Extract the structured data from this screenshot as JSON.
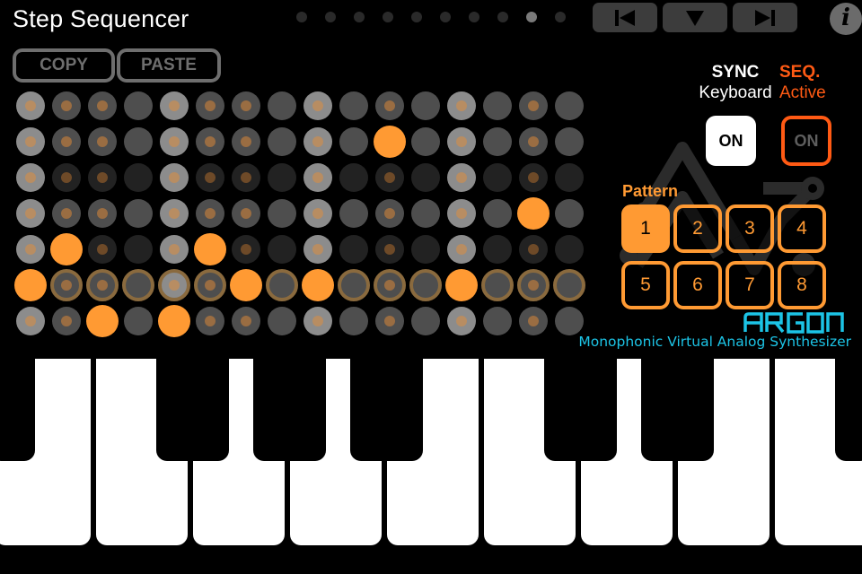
{
  "header": {
    "title": "Step Sequencer",
    "page_count": 10,
    "active_page": 9
  },
  "transport": {
    "prev_icon": "skip-back-icon",
    "menu_icon": "triangle-down-icon",
    "next_icon": "skip-forward-icon"
  },
  "info_button": {
    "icon": "info-icon",
    "glyph": "i"
  },
  "clipboard": {
    "copy_label": "COPY",
    "paste_label": "PASTE"
  },
  "sequencer": {
    "columns": 16,
    "rows": 7,
    "legend": {
      "L": "light-gray step",
      "D": "dark-gray step",
      "K": "very-dark step",
      "O": "active note (orange)",
      "R": "ringed step (playhead row)"
    },
    "grid": [
      [
        "Ld",
        "Dd",
        "Dd",
        "D",
        "Ld",
        "Dd",
        "Dd",
        "D",
        "Ld",
        "D",
        "Dd",
        "D",
        "Ld",
        "D",
        "Dd",
        "D"
      ],
      [
        "Ld",
        "Dd",
        "Dd",
        "D",
        "Ld",
        "Dd",
        "Dd",
        "D",
        "Ld",
        "D",
        "O",
        "D",
        "Ld",
        "D",
        "Dd",
        "D"
      ],
      [
        "Ld",
        "Kd",
        "Kd",
        "K",
        "Ld",
        "Kd",
        "Kd",
        "K",
        "Ld",
        "K",
        "Kd",
        "K",
        "Ld",
        "K",
        "Kd",
        "K"
      ],
      [
        "Ld",
        "Dd",
        "Dd",
        "D",
        "Ld",
        "Dd",
        "Dd",
        "D",
        "Ld",
        "D",
        "Dd",
        "D",
        "Ld",
        "D",
        "O",
        "D"
      ],
      [
        "Ld",
        "O",
        "Kd",
        "K",
        "Ld",
        "O",
        "Kd",
        "K",
        "Ld",
        "K",
        "Kd",
        "K",
        "Ld",
        "K",
        "Kd",
        "K"
      ],
      [
        "O",
        "Rd",
        "Rd",
        "R",
        "RLd",
        "Rd",
        "O",
        "R",
        "O",
        "R",
        "Rd",
        "R",
        "O",
        "R",
        "Rd",
        "R"
      ],
      [
        "Ld",
        "Dd",
        "O",
        "D",
        "O",
        "Dd",
        "Dd",
        "D",
        "Ld",
        "D",
        "Dd",
        "D",
        "Ld",
        "D",
        "Dd",
        "D"
      ]
    ]
  },
  "sync": {
    "heading": "SYNC",
    "sub": "Keyboard",
    "button_label": "ON",
    "state": "on"
  },
  "seq": {
    "heading": "SEQ.",
    "sub": "Active",
    "button_label": "ON",
    "state": "off"
  },
  "pattern": {
    "label": "Pattern",
    "buttons": [
      "1",
      "2",
      "3",
      "4",
      "5",
      "6",
      "7",
      "8"
    ],
    "selected": "1"
  },
  "brand": {
    "name": "ARGON",
    "tagline": "Monophonic Virtual Analog Synthesizer"
  },
  "keyboard": {
    "white_keys": 9,
    "black_keys": 7
  },
  "colors": {
    "accent_orange": "#ff9a33",
    "seq_red_orange": "#ff5a14",
    "brand_cyan": "#1cc4e6",
    "step_light": "#8c8c8c",
    "step_dark": "#4e4e4e",
    "step_very_dark": "#222222",
    "ring": "#8a6a3e",
    "dot_on_light": "#b88d62",
    "dot_on_dark": "#9a6d42",
    "dot_on_very_dark": "#6e4a28"
  }
}
